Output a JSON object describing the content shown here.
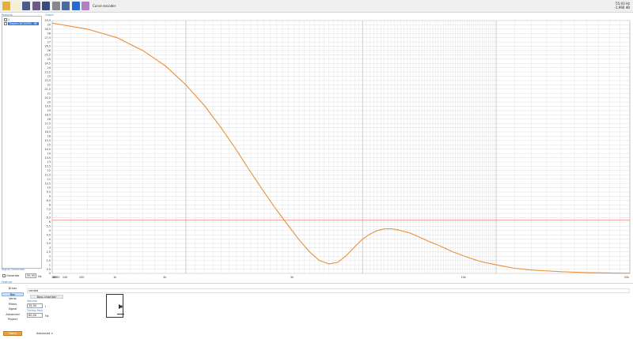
{
  "toolbar": {
    "buttons": [
      {
        "name": "open-folder-icon",
        "color": "#e0b040"
      },
      {
        "name": "new-document-icon",
        "color": "#f5f0d0"
      },
      {
        "name": "save-icon",
        "color": "#4a5a8a"
      },
      {
        "name": "export-icon",
        "color": "#6a5a8a"
      },
      {
        "name": "save-all-icon",
        "color": "#3a4a7a"
      },
      {
        "name": "disk-icon",
        "color": "#888888"
      },
      {
        "name": "wrench-icon",
        "color": "#4a6aa0"
      },
      {
        "name": "info-icon",
        "color": "#2a6acc"
      },
      {
        "name": "curve-encoder-icon",
        "color": "#b080c0"
      }
    ],
    "curve_label": "Curve encoder"
  },
  "readout": {
    "frequency": "55,93  Hz",
    "level": "-1,966  dB"
  },
  "projects": {
    "label": "Projects",
    "items": [
      {
        "label": "1",
        "selected": false
      },
      {
        "label": "Dayton-DC300RS - BE",
        "selected": true
      }
    ]
  },
  "graph": {
    "label": "Graph"
  },
  "signal_generator": {
    "label": "Signal Generator",
    "checkbox_label": "Generate",
    "frequency": "55,93",
    "unit": "Hz"
  },
  "bottom": {
    "feature_label": "Feature",
    "nav": [
      "Driver",
      "Box",
      "Vents",
      "Filters",
      "Signal",
      "Advanced",
      "Project"
    ],
    "selected_nav": "Box",
    "name_value": "vented",
    "tab": "Bass chamber",
    "volume_label": "Volume",
    "volume_value": "35,00",
    "volume_unit": "l",
    "tuning_label": "Tuning freq.",
    "tuning_value": "60,00",
    "tuning_unit": "Hz",
    "done_label": "Done",
    "advanced_label": "Advanced >"
  },
  "chart_data": {
    "type": "line",
    "title": "",
    "xlabel": "",
    "ylabel": "",
    "x_scale": "log",
    "xlim": [
      10,
      200
    ],
    "ylim": [
      0,
      29.5
    ],
    "x_ticks": [
      "10",
      "20",
      "30",
      "50",
      "100",
      "200",
      "1k",
      "2k",
      "5k",
      "10k",
      "20k"
    ],
    "y_ticks": [
      "29.5",
      "29",
      "28.5",
      "28",
      "27.5",
      "27",
      "26.5",
      "26",
      "25.5",
      "25",
      "24.5",
      "24",
      "23.5",
      "23",
      "22.5",
      "22",
      "21.5",
      "21",
      "20.5",
      "20",
      "19.5",
      "19",
      "18.5",
      "18",
      "17.5",
      "17",
      "16.5",
      "16",
      "15.5",
      "15",
      "14.5",
      "14",
      "13.5",
      "13",
      "12.5",
      "12",
      "11.5",
      "11",
      "10.5",
      "10",
      "9.5",
      "9",
      "8.5",
      "8",
      "7.5",
      "7",
      "6.5",
      "6",
      "5.5",
      "5",
      "4.5",
      "4",
      "3.5",
      "3",
      "2.5",
      "2",
      "1.5",
      "1",
      "0.5",
      "0"
    ],
    "reference_line": {
      "y": 6.2,
      "color": "#e05040"
    },
    "series": [
      {
        "color": "#e8903a",
        "x": [
          10,
          12,
          14,
          16,
          18,
          20,
          22,
          24,
          26,
          28,
          30,
          32,
          34,
          36,
          38,
          40,
          42,
          44,
          46,
          48,
          50,
          52,
          54,
          56,
          58,
          60,
          62,
          64,
          66,
          68,
          70,
          74,
          80,
          86,
          92,
          100,
          110,
          120,
          140,
          160,
          180,
          200
        ],
        "y": [
          29.2,
          28.5,
          27.5,
          26.0,
          24.2,
          22.0,
          19.6,
          17.0,
          14.4,
          11.8,
          9.5,
          7.4,
          5.6,
          3.9,
          2.5,
          1.5,
          1.1,
          1.3,
          2.1,
          3.1,
          4.0,
          4.6,
          5.0,
          5.2,
          5.2,
          5.1,
          4.9,
          4.7,
          4.4,
          4.1,
          3.8,
          3.3,
          2.5,
          1.9,
          1.4,
          1.0,
          0.6,
          0.4,
          0.2,
          0.1,
          0.05,
          0.02
        ]
      }
    ]
  }
}
